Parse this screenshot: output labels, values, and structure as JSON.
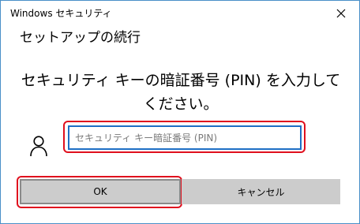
{
  "window": {
    "title": "Windows セキュリティ",
    "close_icon": "close-icon"
  },
  "dialog": {
    "heading": "セットアップの続行",
    "prompt": "セキュリティ キーの暗証番号 (PIN) を入力してください。"
  },
  "pin_field": {
    "value": "",
    "placeholder": "セキュリティ キー暗証番号 (PIN)",
    "icon": "user-icon"
  },
  "buttons": {
    "ok_label": "OK",
    "cancel_label": "キャンセル"
  },
  "colors": {
    "highlight": "#e0101e",
    "input_border": "#1f6fc5",
    "button_bg": "#cccccc",
    "window_border": "#4a90c8"
  }
}
